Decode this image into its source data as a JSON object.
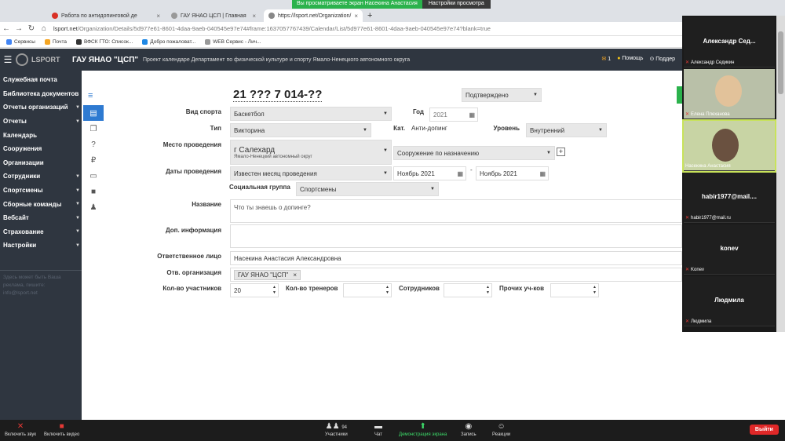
{
  "share_banner": {
    "text": "Вы просматриваете экран Насекина Анастасия",
    "options": "Настройки просмотра"
  },
  "tabs": [
    {
      "label": "Работа по антидопинговой де"
    },
    {
      "label": "ГАУ ЯНАО ЦСП | Главная"
    },
    {
      "label": "https://lsport.net/Organization/"
    }
  ],
  "url": {
    "host": "lsport.net",
    "path": "/Organization/Details/5d977e61-8601-4daa-9aeb-040545e97e74#frame:1637057767439/Calendar/List/5d977e61-8601-4daa-9aeb-040545e97e74?blank=true"
  },
  "bookmarks": [
    "Сервисы",
    "Почта",
    "ВФСК ГТО: Список...",
    "Добро пожаловат...",
    "WEB Сервис - Лич..."
  ],
  "header": {
    "logo": "LSPORT",
    "org": "ГАУ ЯНАО \"ЦСП\"",
    "project": "Проект календаре Департамент по физической культуре и спорту Ямало-Ненецкого автономного округа",
    "mail_count": "1",
    "help": "Помощь",
    "support": "Поддер"
  },
  "sidebar": {
    "items": [
      {
        "label": "Служебная почта",
        "arrow": false
      },
      {
        "label": "Библиотека документов",
        "arrow": false
      },
      {
        "label": "Отчеты организаций",
        "arrow": true
      },
      {
        "label": "Отчеты",
        "arrow": true
      },
      {
        "label": "Календарь",
        "arrow": false
      },
      {
        "label": "Сооружения",
        "arrow": false
      },
      {
        "label": "Организации",
        "arrow": false
      },
      {
        "label": "Сотрудники",
        "arrow": true
      },
      {
        "label": "Спортсмены",
        "arrow": true
      },
      {
        "label": "Сборные команды",
        "arrow": true
      },
      {
        "label": "Вебсайт",
        "arrow": true
      },
      {
        "label": "Страхование",
        "arrow": true
      },
      {
        "label": "Настройки",
        "arrow": true
      }
    ],
    "faded_note": "Здесь может быть Ваша реклама, пишите: info@lsport.net"
  },
  "form": {
    "number": "21 ??? 7 014-??",
    "status": "Подтверждено",
    "sport_label": "Вид спорта",
    "sport": "Баскетбол",
    "year_label": "Год",
    "year": "2021",
    "type_label": "Тип",
    "type": "Викторина",
    "cat_label": "Кат.",
    "cat": "Анти-допинг",
    "level_label": "Уровень",
    "level": "Внутренний",
    "place_label": "Место проведения",
    "place_city": "г Салехард",
    "place_region": "Ямало-Ненецкий автономный округ",
    "facility": "Сооружение по назначению",
    "dates_label": "Даты проведения",
    "dates_mode": "Известен месяц проведения",
    "date_from": "Ноябрь 2021",
    "date_to": "Ноябрь 2021",
    "date_sep": "-",
    "social_label": "Социальная группа",
    "social": "Спортсмены",
    "name_label": "Название",
    "name": "Что ты знаешь о допинге?",
    "extra_label": "Доп. информация",
    "resp_label": "Ответственное лицо",
    "resp": "Насекина Анастасия Александровна",
    "resp_org_label": "Отв. организация",
    "resp_org": "ГАУ ЯНАО \"ЦСП\"",
    "participants_label": "Кол-во участников",
    "participants": "20",
    "trainers_label": "Кол-во тренеров",
    "staff_label": "Сотрудников",
    "others_label": "Прочих уч-ков"
  },
  "participants_panel": [
    {
      "name": "Александр Сед...",
      "caption": "Александр Седикин",
      "video": false
    },
    {
      "name": "",
      "caption": "Елена Плеханова",
      "video": true
    },
    {
      "name": "",
      "caption": "Насекина Анастасия",
      "video": true
    },
    {
      "name": "habir1977@mail....",
      "caption": "habir1977@mail.ru",
      "video": false
    },
    {
      "name": "konev",
      "caption": "Konev",
      "video": false
    },
    {
      "name": "Людмила",
      "caption": "Людмила",
      "video": false
    }
  ],
  "zoom_toolbar": {
    "unmute": "Включить звук",
    "video": "Включить видео",
    "participants": "Участники",
    "participants_count": "94",
    "chat": "Чат",
    "share": "Демонстрация экрана",
    "record": "Запись",
    "reactions": "Реакции",
    "leave": "Выйти"
  }
}
